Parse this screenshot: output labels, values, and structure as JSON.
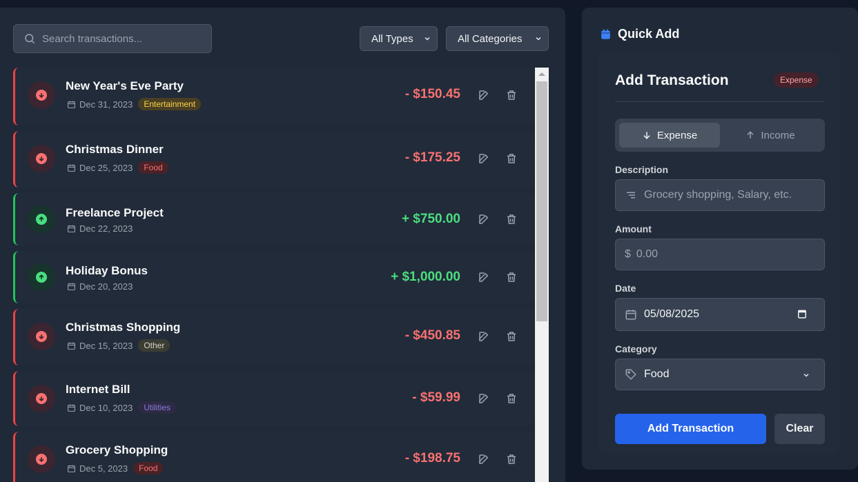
{
  "search": {
    "placeholder": "Search transactions..."
  },
  "filters": {
    "type": "All Types",
    "category": "All Categories"
  },
  "colors": {
    "expense": "#f87171",
    "income": "#4ade80",
    "accent": "#2563eb"
  },
  "transactions": [
    {
      "title": "New Year's Eve Party",
      "date": "Dec 31, 2023",
      "category": "Entertainment",
      "amount": "- $150.45",
      "kind": "expense"
    },
    {
      "title": "Christmas Dinner",
      "date": "Dec 25, 2023",
      "category": "Food",
      "amount": "- $175.25",
      "kind": "expense"
    },
    {
      "title": "Freelance Project",
      "date": "Dec 22, 2023",
      "category": "",
      "amount": "+ $750.00",
      "kind": "income"
    },
    {
      "title": "Holiday Bonus",
      "date": "Dec 20, 2023",
      "category": "",
      "amount": "+ $1,000.00",
      "kind": "income"
    },
    {
      "title": "Christmas Shopping",
      "date": "Dec 15, 2023",
      "category": "Other",
      "amount": "- $450.85",
      "kind": "expense"
    },
    {
      "title": "Internet Bill",
      "date": "Dec 10, 2023",
      "category": "Utilities",
      "amount": "- $59.99",
      "kind": "expense"
    },
    {
      "title": "Grocery Shopping",
      "date": "Dec 5, 2023",
      "category": "Food",
      "amount": "- $198.75",
      "kind": "expense"
    }
  ],
  "quick_add": {
    "heading": "Quick Add",
    "card_title": "Add Transaction",
    "badge": "Expense",
    "toggle": {
      "expense": "Expense",
      "income": "Income"
    },
    "description": {
      "label": "Description",
      "placeholder": "Grocery shopping, Salary, etc."
    },
    "amount": {
      "label": "Amount",
      "symbol": "$",
      "placeholder": "0.00"
    },
    "date": {
      "label": "Date",
      "value": "05/08/2025"
    },
    "category": {
      "label": "Category",
      "value": "Food"
    },
    "add_label": "Add Transaction",
    "clear_label": "Clear"
  }
}
